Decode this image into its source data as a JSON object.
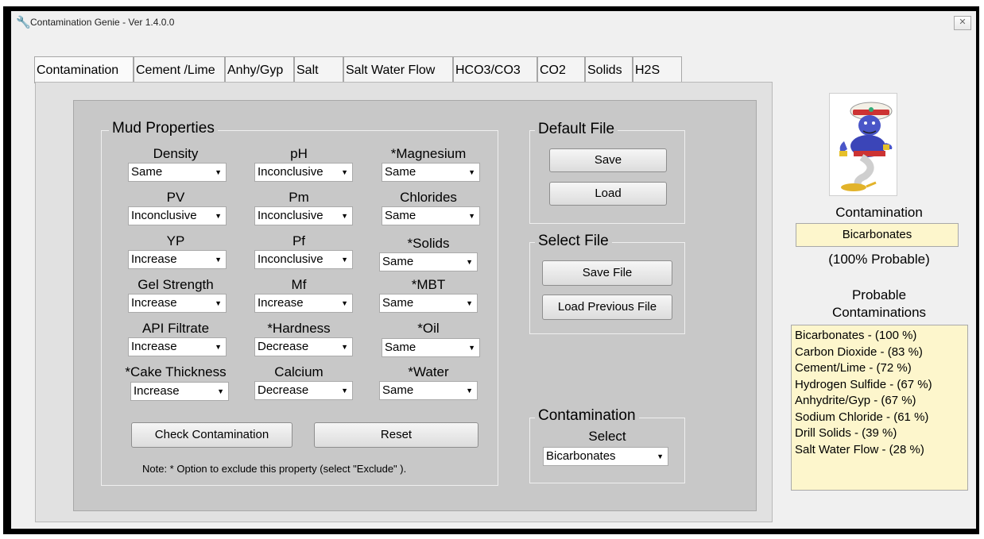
{
  "window": {
    "title": "Contamination Genie - Ver 1.4.0.0",
    "close_glyph": "✕"
  },
  "tabs": [
    "Contamination",
    "Cement /Lime",
    "Anhy/Gyp",
    "Salt",
    "Salt Water Flow",
    "HCO3/CO3",
    "CO2",
    "Solids",
    "H2S"
  ],
  "mud_properties": {
    "title": "Mud Properties",
    "col1": [
      {
        "label": "Density",
        "value": "Same"
      },
      {
        "label": "PV",
        "value": "Inconclusive"
      },
      {
        "label": "YP",
        "value": "Increase"
      },
      {
        "label": "Gel Strength",
        "value": "Increase"
      },
      {
        "label": "API Filtrate",
        "value": "Increase"
      },
      {
        "label": "*Cake Thickness",
        "value": "Increase"
      }
    ],
    "col2": [
      {
        "label": "pH",
        "value": "Inconclusive"
      },
      {
        "label": "Pm",
        "value": "Inconclusive"
      },
      {
        "label": "Pf",
        "value": "Inconclusive"
      },
      {
        "label": "Mf",
        "value": "Increase"
      },
      {
        "label": "*Hardness",
        "value": "Decrease"
      },
      {
        "label": "Calcium",
        "value": "Decrease"
      }
    ],
    "col3": [
      {
        "label": "*Magnesium",
        "value": "Same"
      },
      {
        "label": "Chlorides",
        "value": "Same"
      },
      {
        "label": "*Solids",
        "value": "Same"
      },
      {
        "label": "*MBT",
        "value": "Same"
      },
      {
        "label": "*Oil",
        "value": "Same"
      },
      {
        "label": "*Water",
        "value": "Same"
      }
    ],
    "check_button": "Check Contamination",
    "reset_button": "Reset",
    "note": "Note: * Option to exclude this property (select \"Exclude\" )."
  },
  "default_file": {
    "title": "Default File",
    "save": "Save",
    "load": "Load"
  },
  "select_file": {
    "title": "Select File",
    "save": "Save File",
    "load": "Load Previous File"
  },
  "contamination_select": {
    "title": "Contamination",
    "subtitle": "Select",
    "value": "Bicarbonates"
  },
  "result": {
    "label": "Contamination",
    "value": "Bicarbonates",
    "probability": "(100% Probable)",
    "list_title_1": "Probable",
    "list_title_2": "Contaminations",
    "list": [
      "Bicarbonates - (100 %)",
      "Carbon Dioxide - (83 %)",
      "Cement/Lime - (72 %)",
      "Hydrogen Sulfide - (67 %)",
      "Anhydrite/Gyp - (67 %)",
      "Sodium Chloride - (61 %)",
      "Drill Solids - (39 %)",
      "Salt Water Flow - (28 %)"
    ]
  }
}
